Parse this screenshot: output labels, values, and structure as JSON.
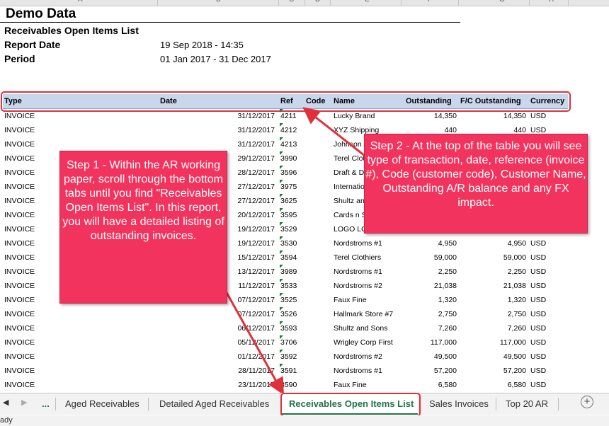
{
  "columns_header": [
    "A",
    "B",
    "C",
    "D",
    "E",
    "F",
    "G",
    "H"
  ],
  "report": {
    "company": "Demo Data",
    "list_title": "Receivables Open Items List",
    "report_date_label": "Report Date",
    "report_date_value": "19 Sep 2018 - 14:35",
    "period_label": "Period",
    "period_value": "01 Jan 2017 - 31 Dec 2017"
  },
  "table": {
    "headers": {
      "type": "Type",
      "date": "Date",
      "ref": "Ref",
      "code": "Code",
      "name": "Name",
      "outstanding": "Outstanding",
      "fc": "F/C Outstanding",
      "currency": "Currency"
    },
    "rows": [
      {
        "type": "INVOICE",
        "date": "31/12/2017",
        "ref": "4211",
        "name": "Lucky Brand",
        "out": "14,350",
        "fc": "14,350",
        "cur": "USD"
      },
      {
        "type": "INVOICE",
        "date": "31/12/2017",
        "ref": "4212",
        "name": "XYZ Shipping",
        "out": "440",
        "fc": "440",
        "cur": "USD"
      },
      {
        "type": "INVOICE",
        "date": "31/12/2017",
        "ref": "4213",
        "name": "Johnson",
        "out": "",
        "fc": "",
        "cur": ""
      },
      {
        "type": "INVOICE",
        "date": "29/12/2017",
        "ref": "3990",
        "name": "Terel Clot",
        "out": "",
        "fc": "",
        "cur": ""
      },
      {
        "type": "INVOICE",
        "date": "28/12/2017",
        "ref": "3596",
        "name": "Draft & D",
        "out": "",
        "fc": "",
        "cur": ""
      },
      {
        "type": "INVOICE",
        "date": "27/12/2017",
        "ref": "3975",
        "name": "Internatio",
        "out": "",
        "fc": "",
        "cur": ""
      },
      {
        "type": "INVOICE",
        "date": "27/12/2017",
        "ref": "3625",
        "name": "Shultz an",
        "out": "",
        "fc": "",
        "cur": ""
      },
      {
        "type": "INVOICE",
        "date": "20/12/2017",
        "ref": "3595",
        "name": "Cards n S",
        "out": "",
        "fc": "",
        "cur": ""
      },
      {
        "type": "INVOICE",
        "date": "19/12/2017",
        "ref": "3529",
        "name": "LOGO LO",
        "out": "",
        "fc": "",
        "cur": ""
      },
      {
        "type": "INVOICE",
        "date": "19/12/2017",
        "ref": "3530",
        "name": "Nordstroms #1",
        "out": "4,950",
        "fc": "4,950",
        "cur": "USD"
      },
      {
        "type": "INVOICE",
        "date": "15/12/2017",
        "ref": "3594",
        "name": "Terel Clothiers",
        "out": "59,000",
        "fc": "59,000",
        "cur": "USD"
      },
      {
        "type": "INVOICE",
        "date": "13/12/2017",
        "ref": "3989",
        "name": "Nordstroms #1",
        "out": "2,250",
        "fc": "2,250",
        "cur": "USD"
      },
      {
        "type": "INVOICE",
        "date": "11/12/2017",
        "ref": "3533",
        "name": "Nordstroms #2",
        "out": "21,038",
        "fc": "21,038",
        "cur": "USD"
      },
      {
        "type": "INVOICE",
        "date": "07/12/2017",
        "ref": "3525",
        "name": "Faux Fine",
        "out": "1,320",
        "fc": "1,320",
        "cur": "USD"
      },
      {
        "type": "INVOICE",
        "date": "07/12/2017",
        "ref": "3526",
        "name": "Hallmark Store #7",
        "out": "2,750",
        "fc": "2,750",
        "cur": "USD"
      },
      {
        "type": "INVOICE",
        "date": "06/12/2017",
        "ref": "3593",
        "name": "Shultz and Sons",
        "out": "7,260",
        "fc": "7,260",
        "cur": "USD"
      },
      {
        "type": "INVOICE",
        "date": "05/12/2017",
        "ref": "3706",
        "name": "Wrigley Corp First",
        "out": "117,000",
        "fc": "117,000",
        "cur": "USD"
      },
      {
        "type": "INVOICE",
        "date": "01/12/2017",
        "ref": "3592",
        "name": "Nordstroms #2",
        "out": "49,500",
        "fc": "49,500",
        "cur": "USD"
      },
      {
        "type": "INVOICE",
        "date": "28/11/2017",
        "ref": "3591",
        "name": "Nordstroms #1",
        "out": "57,200",
        "fc": "57,200",
        "cur": "USD"
      },
      {
        "type": "INVOICE",
        "date": "23/11/2017",
        "ref": "3590",
        "name": "Faux Fine",
        "out": "6,580",
        "fc": "6,580",
        "cur": "USD"
      }
    ]
  },
  "callouts": {
    "step1": "Step 1 - Within the AR working paper, scroll through the bottom tabs until you find \"Receivables Open Items List\". In this report, you will have a detailed listing of outstanding invoices.",
    "step2": "Step 2 - At the top of the table you will see type of transaction, date, reference (invoice #), Code (customer code), Customer Name, Outstanding A/R balance and any FX impact."
  },
  "tabs": {
    "ellipsis": "...",
    "items": [
      "Aged Receivables",
      "Detailed Aged Receivables",
      "Receivables Open Items List",
      "Sales Invoices",
      "Top 20 AR"
    ],
    "active": "Receivables Open Items List",
    "add_icon": "+"
  },
  "status": {
    "text": "ady"
  },
  "colors": {
    "callout": "#f2335e",
    "highlight_border": "#e0303a",
    "active_tab": "#217346",
    "header_fill": "#c9d7ec"
  }
}
